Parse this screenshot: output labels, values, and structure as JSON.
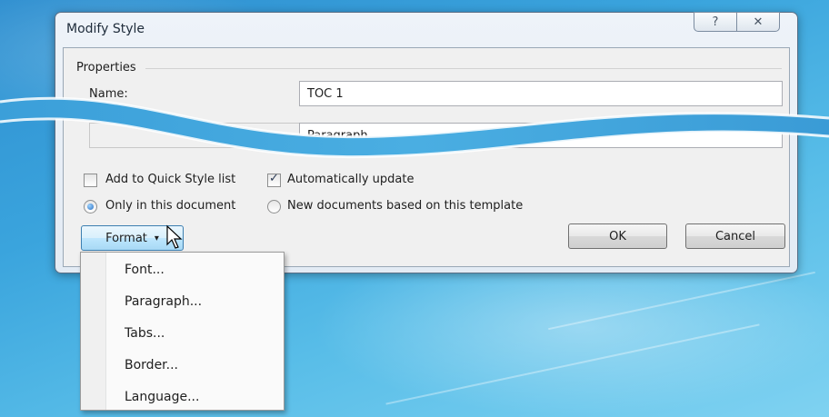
{
  "dialog": {
    "title": "Modify Style",
    "help_icon": "question-icon",
    "close_icon": "close-icon"
  },
  "properties": {
    "group_label": "Properties",
    "name_label": "Name:",
    "name_value": "TOC 1",
    "style_type_value": "Paragraph"
  },
  "options": {
    "add_quick_style": {
      "label": "Add to Quick Style list",
      "checked": false
    },
    "auto_update": {
      "label": "Automatically update",
      "checked": true
    },
    "only_this_doc": {
      "label": "Only in this document",
      "selected": true
    },
    "new_docs_template": {
      "label": "New documents based on this template",
      "selected": false
    }
  },
  "buttons": {
    "format": "Format",
    "format_arrow": "▾",
    "ok": "OK",
    "cancel": "Cancel"
  },
  "format_menu": {
    "items": [
      "Font...",
      "Paragraph...",
      "Tabs...",
      "Border...",
      "Language..."
    ]
  },
  "colors": {
    "background": "#3aa4dd",
    "format_button": "#bee6fd"
  }
}
